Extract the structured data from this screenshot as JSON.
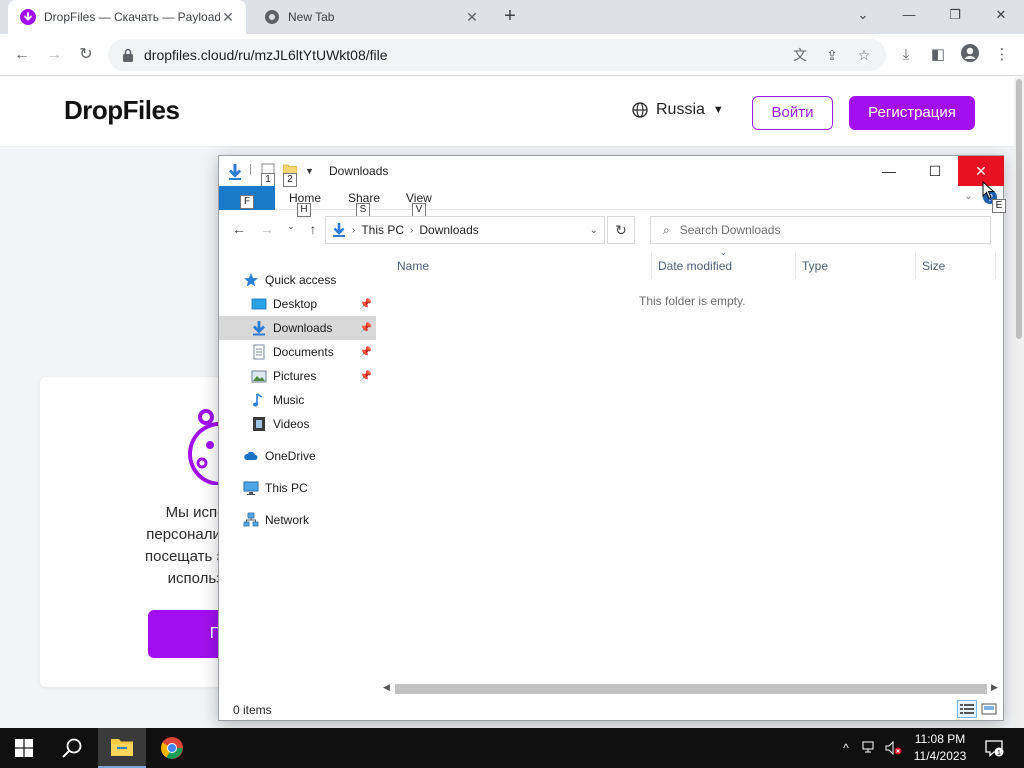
{
  "browser": {
    "tabs": [
      {
        "title": "DropFiles — Скачать — Payload",
        "active": true
      },
      {
        "title": "New Tab",
        "active": false
      }
    ],
    "url": "dropfiles.cloud/ru/mzJL6ltYtUWkt08/file",
    "accent": "#a20ff0"
  },
  "site": {
    "logo": "DropFiles",
    "language": "Russia",
    "login": "Войти",
    "register": "Регистрация",
    "cookie_lines": [
      "Мы используем",
      "персонализации ваш",
      "посещать этот веб-са",
      "использование"
    ],
    "cookie_button": "По"
  },
  "explorer": {
    "title": "Downloads",
    "keytips": {
      "qa1": "1",
      "qa2": "2",
      "file": "F",
      "home": "H",
      "share": "S",
      "view": "V",
      "expand": "E"
    },
    "ribbon": {
      "file": "F",
      "home": "Home",
      "share": "Share",
      "view": "View"
    },
    "address": [
      "This PC",
      "Downloads"
    ],
    "search_placeholder": "Search Downloads",
    "nav": [
      {
        "label": "Quick access",
        "icon": "star-icon",
        "pinned": false
      },
      {
        "label": "Desktop",
        "icon": "desktop-icon",
        "pinned": true
      },
      {
        "label": "Downloads",
        "icon": "downloads-icon",
        "pinned": true,
        "selected": true
      },
      {
        "label": "Documents",
        "icon": "documents-icon",
        "pinned": true
      },
      {
        "label": "Pictures",
        "icon": "pictures-icon",
        "pinned": true
      },
      {
        "label": "Music",
        "icon": "music-icon",
        "pinned": false
      },
      {
        "label": "Videos",
        "icon": "videos-icon",
        "pinned": false
      },
      {
        "label": "OneDrive",
        "icon": "cloud-icon",
        "pinned": false
      },
      {
        "label": "This PC",
        "icon": "computer-icon",
        "pinned": false
      },
      {
        "label": "Network",
        "icon": "network-icon",
        "pinned": false
      }
    ],
    "columns": [
      "Name",
      "Date modified",
      "Type",
      "Size"
    ],
    "empty_message": "This folder is empty.",
    "status": "0 items"
  },
  "taskbar": {
    "time": "11:08 PM",
    "date": "11/4/2023",
    "notifications": "1"
  }
}
